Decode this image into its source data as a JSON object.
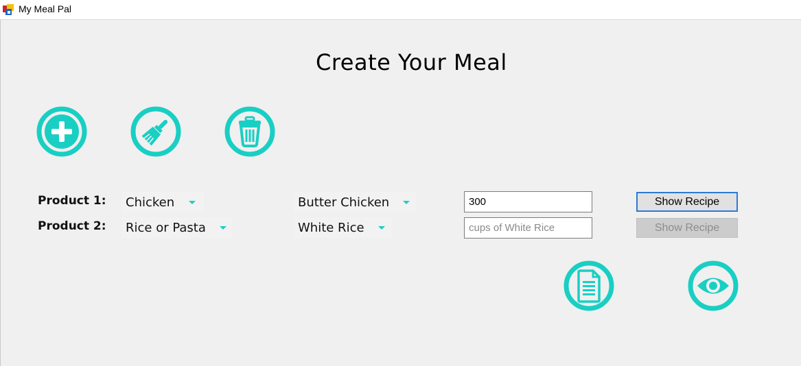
{
  "window": {
    "title": "My Meal Pal"
  },
  "heading": "Create Your Meal",
  "colors": {
    "accent": "#19cfc3",
    "focus": "#2a7ad2"
  },
  "toolbar": {
    "icons": [
      "plus-icon",
      "brush-icon",
      "trash-icon"
    ]
  },
  "rows": [
    {
      "label": "Product 1:",
      "category": "Chicken",
      "product": "Butter Chicken",
      "amount_value": "300",
      "amount_placeholder": "",
      "recipe_button": "Show Recipe",
      "recipe_enabled": true
    },
    {
      "label": "Product 2:",
      "category": "Rice or Pasta",
      "product": "White Rice",
      "amount_value": "",
      "amount_placeholder": "cups of White Rice",
      "recipe_button": "Show Recipe",
      "recipe_enabled": false
    }
  ],
  "bottom_actions": {
    "icons": [
      "document-icon",
      "eye-icon"
    ]
  }
}
